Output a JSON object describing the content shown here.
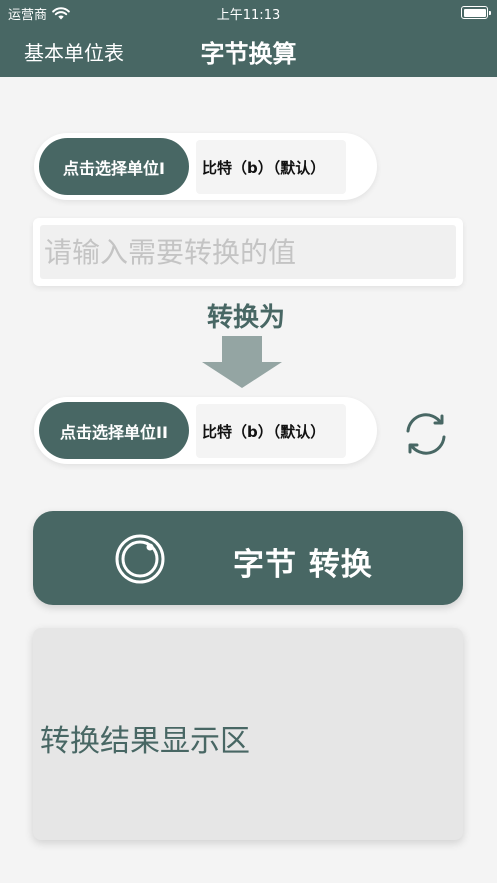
{
  "status_bar": {
    "carrier": "运营商",
    "time": "上午11:13"
  },
  "nav": {
    "back_label": "基本单位表",
    "title": "字节换算"
  },
  "from_unit": {
    "select_label": "点击选择单位I",
    "current_value": "比特（b）（默认）"
  },
  "input": {
    "placeholder": "请输入需要转换的值",
    "value": ""
  },
  "convert_to_label": "转换为",
  "to_unit": {
    "select_label": "点击选择单位II",
    "current_value": "比特（b）（默认）"
  },
  "convert_button": {
    "label": "字节 转换"
  },
  "result": {
    "placeholder": "转换结果显示区"
  },
  "colors": {
    "accent": "#486764",
    "arrow": "#94a5a3",
    "background": "#f4f4f4",
    "result_bg": "#e6e6e6"
  },
  "icons": {
    "wifi": "wifi-icon",
    "battery": "battery-icon",
    "arrow": "arrow-down-icon",
    "swap": "swap-icon",
    "convert": "circle-convert-icon"
  }
}
